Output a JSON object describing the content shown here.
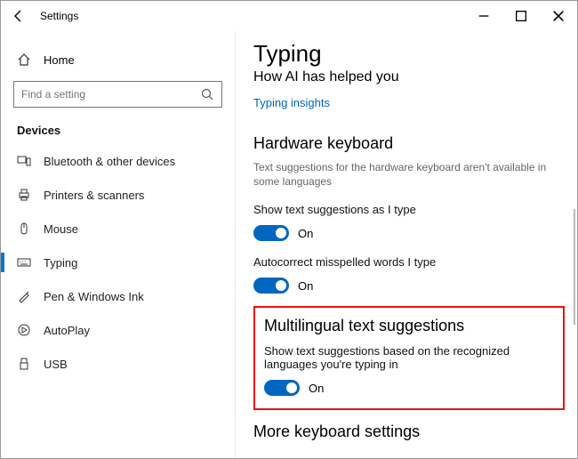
{
  "window": {
    "title": "Settings"
  },
  "sidebar": {
    "home": "Home",
    "search_placeholder": "Find a setting",
    "section": "Devices",
    "items": [
      {
        "label": "Bluetooth & other devices"
      },
      {
        "label": "Printers & scanners"
      },
      {
        "label": "Mouse"
      },
      {
        "label": "Typing"
      },
      {
        "label": "Pen & Windows Ink"
      },
      {
        "label": "AutoPlay"
      },
      {
        "label": "USB"
      }
    ]
  },
  "main": {
    "title": "Typing",
    "subtitle": "How AI has helped you",
    "insights_link": "Typing insights",
    "hw_heading": "Hardware keyboard",
    "hw_desc": "Text suggestions for the hardware keyboard aren't available in some languages",
    "setting1": {
      "label": "Show text suggestions as I type",
      "state": "On"
    },
    "setting2": {
      "label": "Autocorrect misspelled words I type",
      "state": "On"
    },
    "multi_heading": "Multilingual text suggestions",
    "multi_desc": "Show text suggestions based on the recognized languages you're typing in",
    "multi_state": "On",
    "more_heading": "More keyboard settings"
  }
}
